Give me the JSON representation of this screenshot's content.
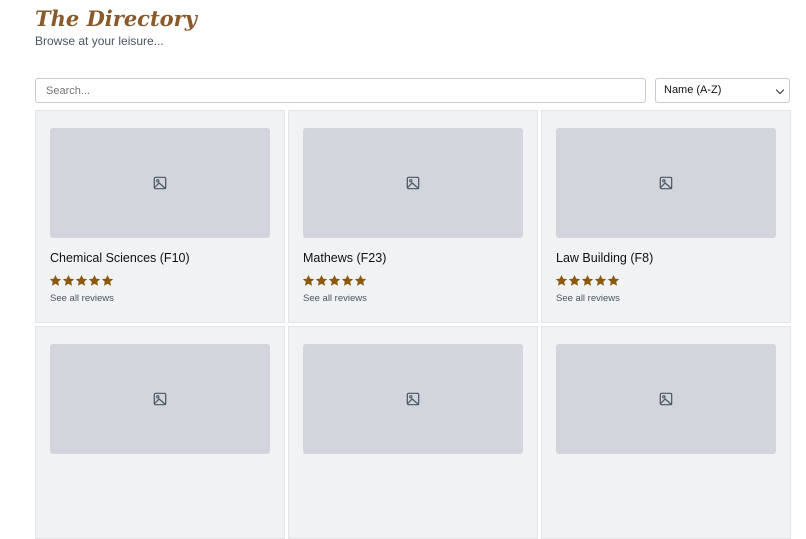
{
  "header": {
    "title": "The Directory",
    "subtitle": "Browse at your leisure..."
  },
  "search": {
    "placeholder": "Search..."
  },
  "sort": {
    "selected": "Name (A-Z)"
  },
  "colors": {
    "accent": "#8a5a2b",
    "star": "#8a5a10",
    "card_bg": "#f1f2f4",
    "placeholder_bg": "#d2d5db"
  },
  "cards": [
    {
      "name": "Chemical Sciences (F10)",
      "rating": 5,
      "reviews_label": "See all reviews",
      "image_icon": "image-icon"
    },
    {
      "name": "Mathews (F23)",
      "rating": 5,
      "reviews_label": "See all reviews",
      "image_icon": "image-icon"
    },
    {
      "name": "Law Building (F8)",
      "rating": 5,
      "reviews_label": "See all reviews",
      "image_icon": "image-icon"
    },
    {
      "image_icon": "image-icon"
    },
    {
      "image_icon": "image-icon"
    },
    {
      "image_icon": "image-icon"
    }
  ]
}
